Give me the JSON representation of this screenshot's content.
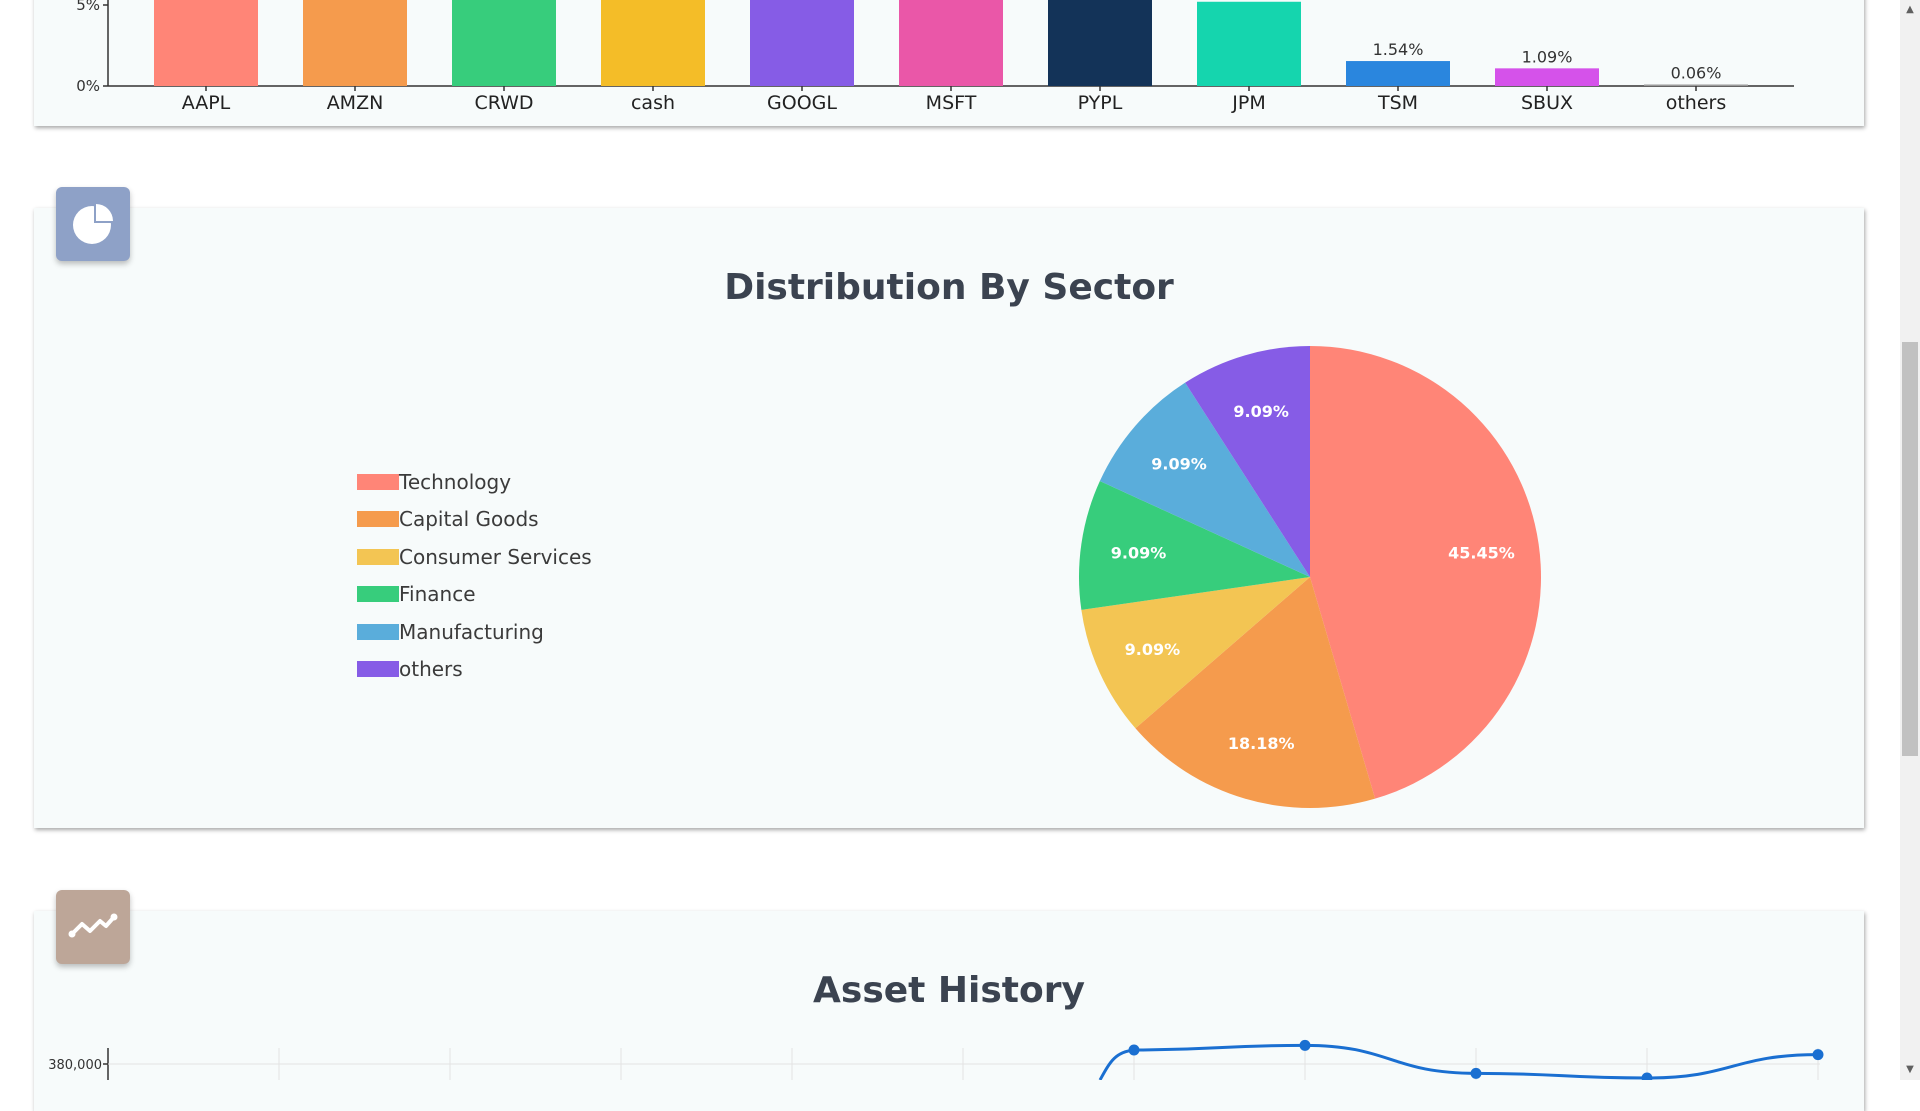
{
  "holdings_chart": {
    "y_ticks": [
      "5%",
      "0%"
    ],
    "categories": [
      "AAPL",
      "AMZN",
      "CRWD",
      "cash",
      "GOOGL",
      "MSFT",
      "PYPL",
      "JPM",
      "TSM",
      "SBUX",
      "others"
    ],
    "colors": [
      "#ff8577",
      "#f59b4d",
      "#37cd7c",
      "#f4bd28",
      "#865ce6",
      "#ea57a8",
      "#133358",
      "#15d5ae",
      "#2a86de",
      "#d552ea",
      "#999999"
    ],
    "value_labels": [
      "",
      "",
      "",
      "",
      "",
      "",
      "",
      "",
      "1.54%",
      "1.09%",
      "0.06%"
    ]
  },
  "sector_chart": {
    "title": "Distribution By Sector",
    "icon": "pie-chart-icon",
    "icon_color": "#8ea1c7"
  },
  "history_chart": {
    "title": "Asset History",
    "icon": "line-chart-icon",
    "icon_color": "#bda698",
    "y_tick_label": "380,000",
    "line_color": "#1a6fd1"
  },
  "chart_data": [
    {
      "type": "bar",
      "title": "",
      "categories": [
        "AAPL",
        "AMZN",
        "CRWD",
        "cash",
        "GOOGL",
        "MSFT",
        "PYPL",
        "JPM",
        "TSM",
        "SBUX",
        "others"
      ],
      "values": [
        null,
        null,
        null,
        null,
        null,
        null,
        null,
        5.2,
        1.54,
        1.09,
        0.06
      ],
      "unit": "%",
      "y_ticks": [
        0,
        5
      ],
      "note": "Bars for AAPL..PYPL extend beyond the visible top edge (cropped)."
    },
    {
      "type": "pie",
      "title": "Distribution By Sector",
      "labels": [
        "Technology",
        "Capital Goods",
        "Consumer Services",
        "Finance",
        "Manufacturing",
        "others"
      ],
      "values": [
        45.45,
        18.18,
        9.09,
        9.09,
        9.09,
        9.09
      ],
      "colors": [
        "#ff8577",
        "#f59b4d",
        "#f3c553",
        "#37cd7c",
        "#5aaddb",
        "#865ce6"
      ],
      "legend": "left"
    },
    {
      "type": "line",
      "title": "Asset History",
      "y_ticks": [
        380000
      ],
      "series": [
        {
          "values": [
            null,
            null,
            null,
            null,
            null,
            null,
            383000,
            384000,
            378000,
            377000,
            382000
          ]
        }
      ],
      "note": "Chart cropped at bottom; only upper portion visible."
    }
  ]
}
